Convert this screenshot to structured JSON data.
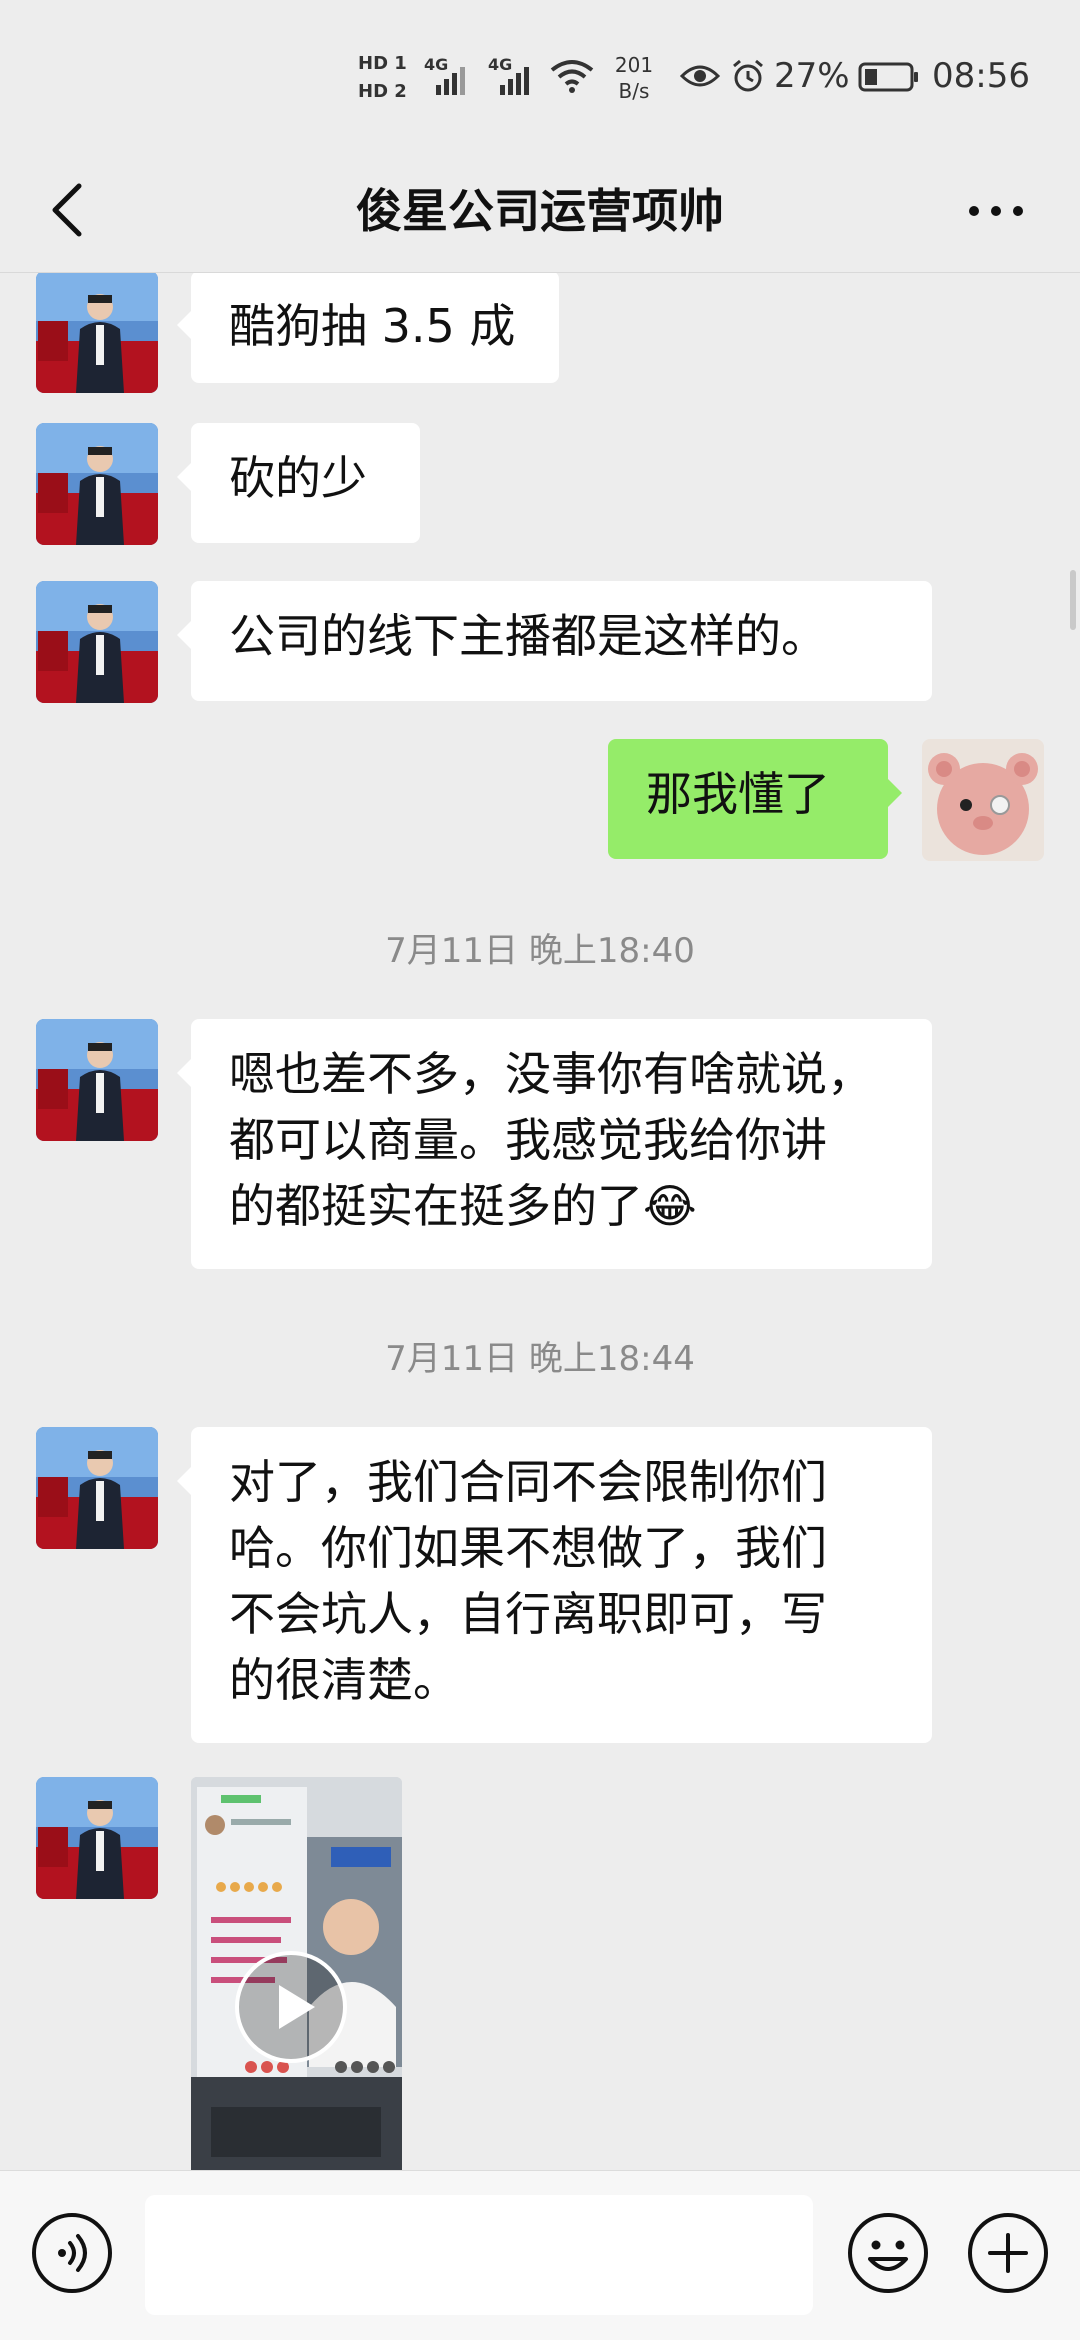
{
  "status_bar": {
    "hd1": "HD 1",
    "hd2": "HD 2",
    "net1": "4G",
    "net2": "4G",
    "speed_value": "201",
    "speed_unit": "B/s",
    "battery_percent": "27%",
    "time": "08:56",
    "icons": [
      "hd-icon",
      "signal-icon",
      "wifi-icon",
      "eye-icon",
      "alarm-icon",
      "battery-icon"
    ]
  },
  "header": {
    "title": "俊星公司运营项帅",
    "back_icon": "chevron-left-icon",
    "more_icon": "more-dots-icon"
  },
  "messages": [
    {
      "side": "left",
      "text": "酷狗抽 3.5 成"
    },
    {
      "side": "left",
      "text": "砍的少"
    },
    {
      "side": "left",
      "text": "公司的线下主播都是这样的。"
    },
    {
      "side": "right",
      "text": "那我懂了"
    },
    {
      "type": "time",
      "text": "7月11日 晚上18:40"
    },
    {
      "side": "left",
      "text": "嗯也差不多，没事你有啥就说，\n都可以商量。我感觉我给你讲\n的都挺实在挺多的了😂"
    },
    {
      "type": "time",
      "text": "7月11日 晚上18:44"
    },
    {
      "side": "left",
      "text": "对了，我们合同不会限制你们\n哈。你们如果不想做了，我们\n不会坑人，自行离职即可，写\n的很清楚。"
    },
    {
      "side": "left",
      "type": "video"
    }
  ],
  "input_bar": {
    "placeholder": "",
    "value": "",
    "icons": [
      "voice-icon",
      "emoji-icon",
      "plus-icon"
    ]
  },
  "colors": {
    "background": "#ededed",
    "bubble_in": "#ffffff",
    "bubble_out": "#95ec69",
    "timestamp": "#8a8a8a"
  }
}
